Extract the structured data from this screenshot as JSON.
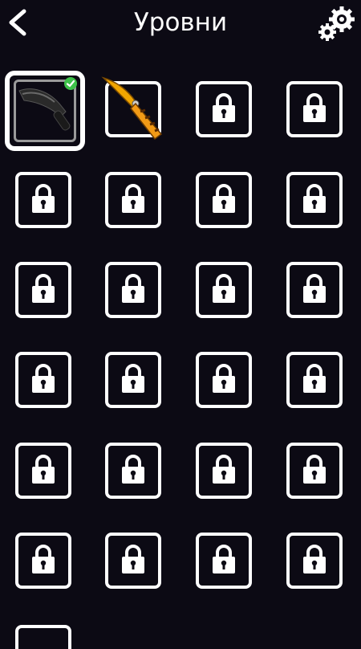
{
  "header": {
    "title": "Уровни",
    "back_icon": "chevron-left-icon",
    "settings_icon": "gears-icon"
  },
  "levels": [
    {
      "state": "selected",
      "item": "dark-knife",
      "completed": true
    },
    {
      "state": "unlocked",
      "item": "gold-flip-knife"
    },
    {
      "state": "locked"
    },
    {
      "state": "locked"
    },
    {
      "state": "locked"
    },
    {
      "state": "locked"
    },
    {
      "state": "locked"
    },
    {
      "state": "locked"
    },
    {
      "state": "locked"
    },
    {
      "state": "locked"
    },
    {
      "state": "locked"
    },
    {
      "state": "locked"
    },
    {
      "state": "locked"
    },
    {
      "state": "locked"
    },
    {
      "state": "locked"
    },
    {
      "state": "locked"
    },
    {
      "state": "locked"
    },
    {
      "state": "locked"
    },
    {
      "state": "locked"
    },
    {
      "state": "locked"
    },
    {
      "state": "locked"
    },
    {
      "state": "locked"
    },
    {
      "state": "locked"
    },
    {
      "state": "locked"
    }
  ],
  "colors": {
    "background": "#0c0a14",
    "tile_border": "#ffffff",
    "check": "#3ec24a"
  }
}
